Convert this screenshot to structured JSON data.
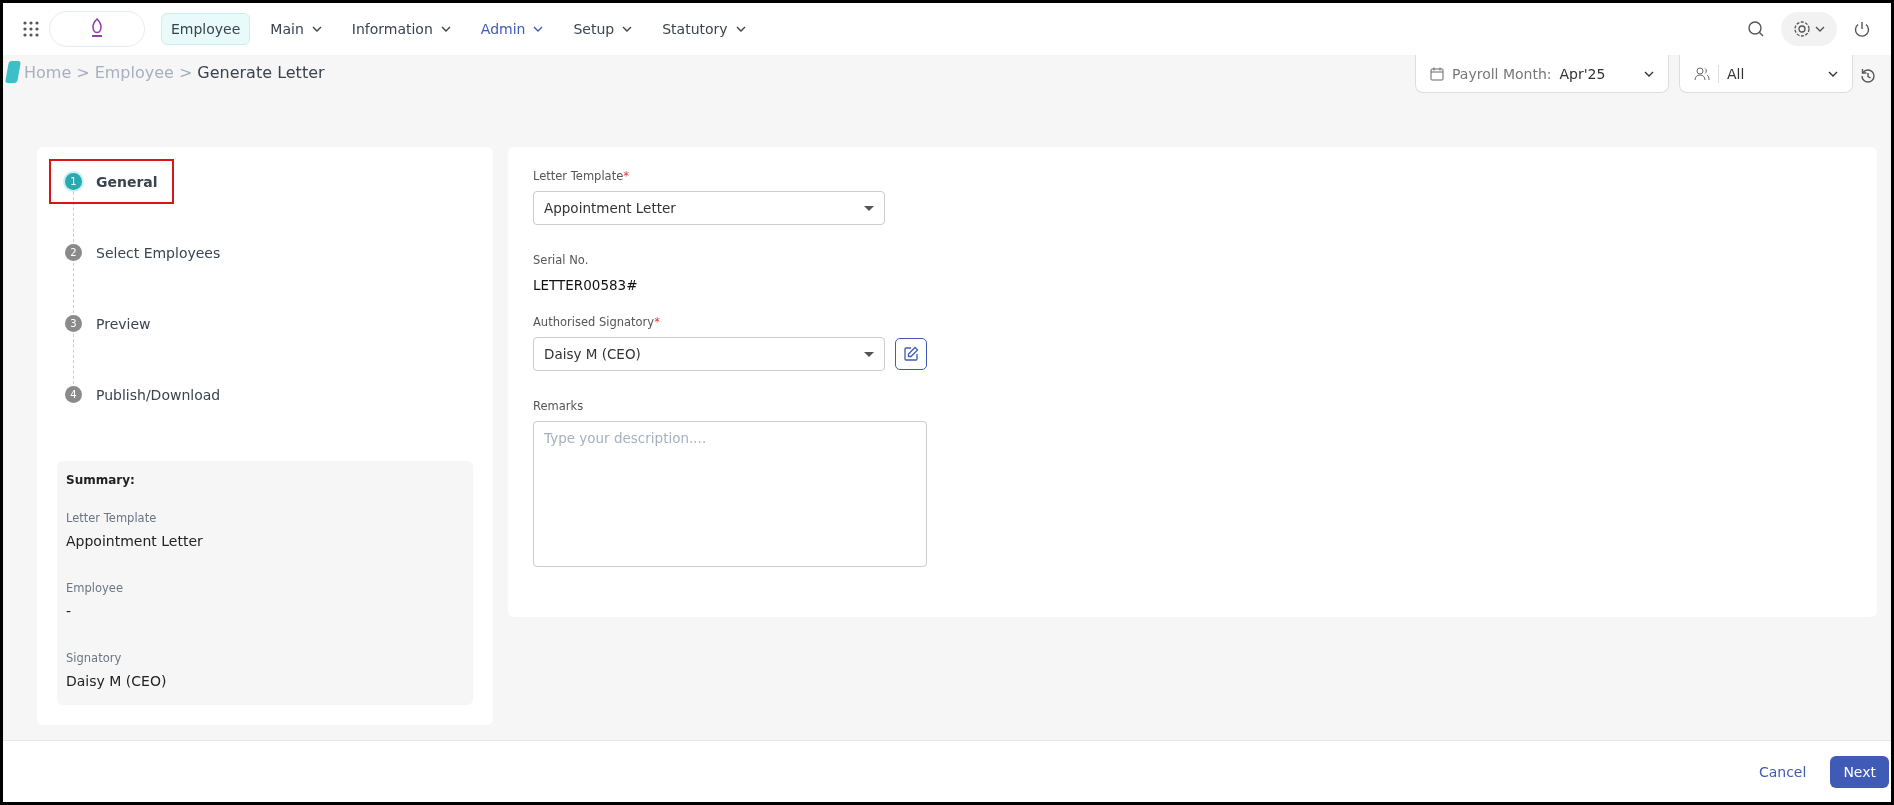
{
  "nav": {
    "items": [
      {
        "label": "Employee",
        "selected": true,
        "current": false,
        "has_menu": false
      },
      {
        "label": "Main",
        "selected": false,
        "current": false,
        "has_menu": true
      },
      {
        "label": "Information",
        "selected": false,
        "current": false,
        "has_menu": true
      },
      {
        "label": "Admin",
        "selected": false,
        "current": true,
        "has_menu": true
      },
      {
        "label": "Setup",
        "selected": false,
        "current": false,
        "has_menu": true
      },
      {
        "label": "Statutory",
        "selected": false,
        "current": false,
        "has_menu": true
      }
    ]
  },
  "breadcrumb": [
    {
      "label": "Home",
      "current": false
    },
    {
      "label": "Employee",
      "current": false
    },
    {
      "label": "Generate Letter",
      "current": true
    }
  ],
  "breadcrumb_separator": ">",
  "payroll_month": {
    "label": "Payroll Month:",
    "value": "Apr'25"
  },
  "group_filter": {
    "value": "All"
  },
  "steps": [
    {
      "number": "1",
      "label": "General",
      "selected": true,
      "highlighted": true
    },
    {
      "number": "2",
      "label": "Select Employees",
      "selected": false,
      "highlighted": false
    },
    {
      "number": "3",
      "label": "Preview",
      "selected": false,
      "highlighted": false
    },
    {
      "number": "4",
      "label": "Publish/Download",
      "selected": false,
      "highlighted": false
    }
  ],
  "summary": {
    "title": "Summary:",
    "items": [
      {
        "label": "Letter Template",
        "value": "Appointment Letter"
      },
      {
        "label": "Employee",
        "value": "-"
      },
      {
        "label": "Signatory",
        "value": "Daisy M (CEO)"
      }
    ]
  },
  "form": {
    "letter_template": {
      "label": "Letter Template",
      "required": true,
      "value": "Appointment Letter"
    },
    "serial_no": {
      "label": "Serial No.",
      "value": "LETTER00583#"
    },
    "signatory": {
      "label": "Authorised Signatory",
      "required": true,
      "value": "Daisy M (CEO)"
    },
    "remarks": {
      "label": "Remarks",
      "placeholder": "Type your description...."
    },
    "required_mark": "*"
  },
  "footer": {
    "cancel": "Cancel",
    "next": "Next"
  }
}
